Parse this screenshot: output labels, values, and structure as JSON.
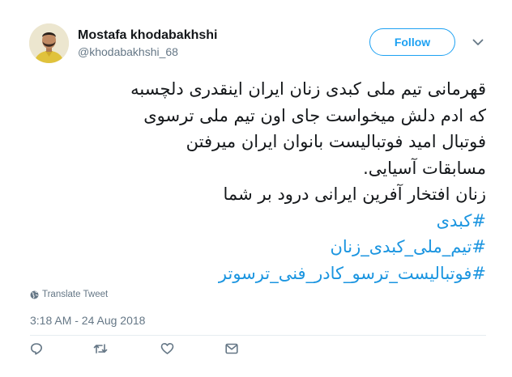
{
  "author": {
    "name": "Mostafa khodabakhshi",
    "handle": "@khodabakhshi_68"
  },
  "follow": {
    "label": "Follow"
  },
  "tweet": {
    "lines": [
      "قهرمانی تیم ملی کبدی زنان ایران اینقدری دلچسبه",
      "که ادم دلش میخواست جای اون تیم ملی ترسوی",
      "فوتبال امید فوتبالیست بانوان ایران میرفتن",
      "مسابقات آسیایی.",
      "زنان افتخار آفرین ایرانی درود بر شما"
    ],
    "hashtags": [
      "#کبدی",
      "#تیم_ملی_کبدی_زنان",
      "#فوتبالیست_ترسو_کادر_فنی_ترسوتر"
    ]
  },
  "translate": {
    "label": "Translate Tweet",
    "icon": "globe-icon"
  },
  "timestamp": "3:18 AM - 24 Aug 2018",
  "actions": {
    "reply_icon": "reply-icon",
    "retweet_icon": "retweet-icon",
    "like_icon": "heart-icon",
    "dm_icon": "envelope-icon"
  },
  "colors": {
    "accent": "#1da1f2",
    "hashtag": "#1b95e0",
    "secondary_text": "#657786",
    "text": "#14171a"
  }
}
